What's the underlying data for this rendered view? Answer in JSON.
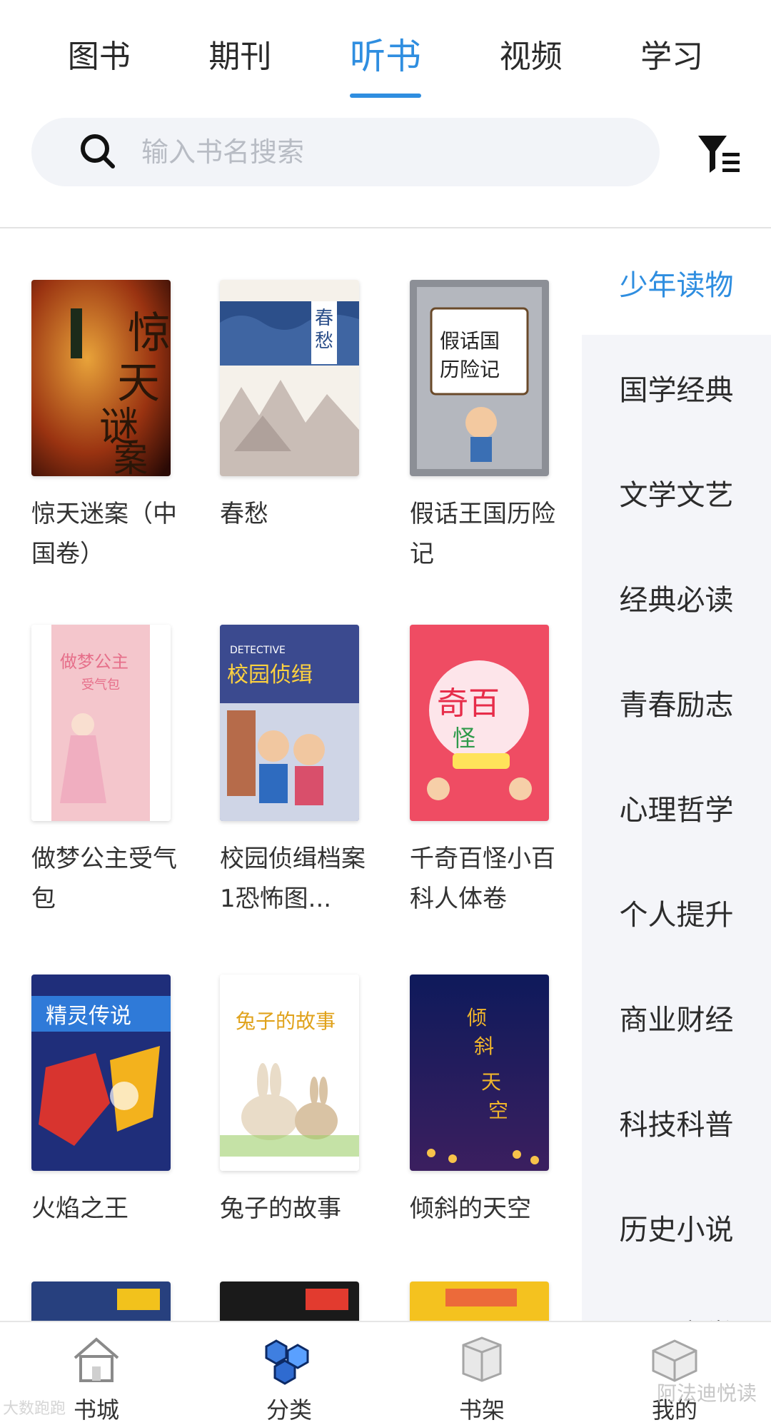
{
  "tabs": [
    {
      "label": "图书",
      "active": false
    },
    {
      "label": "期刊",
      "active": false
    },
    {
      "label": "听书",
      "active": true
    },
    {
      "label": "视频",
      "active": false
    },
    {
      "label": "学习",
      "active": false
    }
  ],
  "search": {
    "placeholder": "输入书名搜索",
    "value": ""
  },
  "books": [
    {
      "title": "惊天迷案（中国卷）",
      "cover_text": "惊天迷案"
    },
    {
      "title": "春愁",
      "cover_text": "春愁"
    },
    {
      "title": "假话王国历险记",
      "cover_text": "假话国历险记"
    },
    {
      "title": "做梦公主受气包",
      "cover_text": "做梦公主受气包"
    },
    {
      "title": "校园侦缉档案1恐怖图...",
      "cover_text": "校园侦缉档案"
    },
    {
      "title": "千奇百怪小百科人体卷",
      "cover_text": "千奇百怪"
    },
    {
      "title": "火焰之王",
      "cover_text": "精灵传说"
    },
    {
      "title": "兔子的故事",
      "cover_text": "兔子的故事"
    },
    {
      "title": "倾斜的天空",
      "cover_text": "倾斜的天空"
    }
  ],
  "categories": [
    {
      "label": "少年读物",
      "active": true
    },
    {
      "label": "国学经典",
      "active": false
    },
    {
      "label": "文学文艺",
      "active": false
    },
    {
      "label": "经典必读",
      "active": false
    },
    {
      "label": "青春励志",
      "active": false
    },
    {
      "label": "心理哲学",
      "active": false
    },
    {
      "label": "个人提升",
      "active": false
    },
    {
      "label": "商业财经",
      "active": false
    },
    {
      "label": "科技科普",
      "active": false
    },
    {
      "label": "历史小说",
      "active": false
    },
    {
      "label": "民国文学",
      "active": false
    }
  ],
  "bottom_nav": [
    {
      "label": "书城",
      "icon": "house-icon",
      "active": false
    },
    {
      "label": "分类",
      "icon": "category-cubes-icon",
      "active": true
    },
    {
      "label": "书架",
      "icon": "bookshelf-icon",
      "active": false
    },
    {
      "label": "我的",
      "icon": "profile-box-icon",
      "active": false
    }
  ],
  "watermark": "阿法迪悦读",
  "watermark_left": "大数跑跑",
  "colors": {
    "accent": "#2f8ee0",
    "sidebar_bg": "#f4f5f9",
    "search_bg": "#f2f4f8"
  }
}
